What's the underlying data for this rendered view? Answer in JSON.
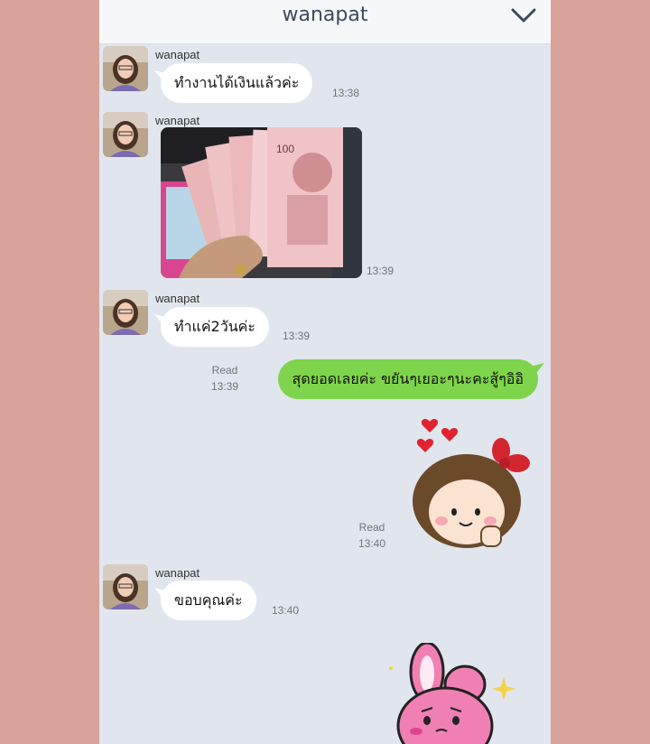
{
  "header": {
    "title": "wanapat",
    "menu_icon": "chevron-down-icon"
  },
  "messages": [
    {
      "type": "in-text",
      "sender": "wanapat",
      "text": "ทำงานได้เงินแล้วค่ะ",
      "time": "13:38"
    },
    {
      "type": "in-image",
      "sender": "wanapat",
      "image": "hand holding 100 baht banknotes",
      "time": "13:39"
    },
    {
      "type": "in-text",
      "sender": "wanapat",
      "text": "ทำแค่2วันค่ะ",
      "time": "13:39"
    },
    {
      "type": "out-text",
      "text": "สุดยอดเลยค่ะ ขยันๆเยอะๆนะคะสู้ๆอิอิ",
      "read": "Read",
      "time": "13:39"
    },
    {
      "type": "out-sticker",
      "sticker": "girl-with-hearts",
      "read": "Read",
      "time": "13:40"
    },
    {
      "type": "in-text",
      "sender": "wanapat",
      "text": "ขอบคุณค่ะ",
      "time": "13:40"
    },
    {
      "type": "out-sticker",
      "sticker": "pink-bunny"
    }
  ],
  "banknote_label": "100",
  "colors": {
    "background": "#d7a39b",
    "chat_bg": "#e1e6ee",
    "outgoing": "#7ed44a",
    "incoming": "#ffffff"
  }
}
